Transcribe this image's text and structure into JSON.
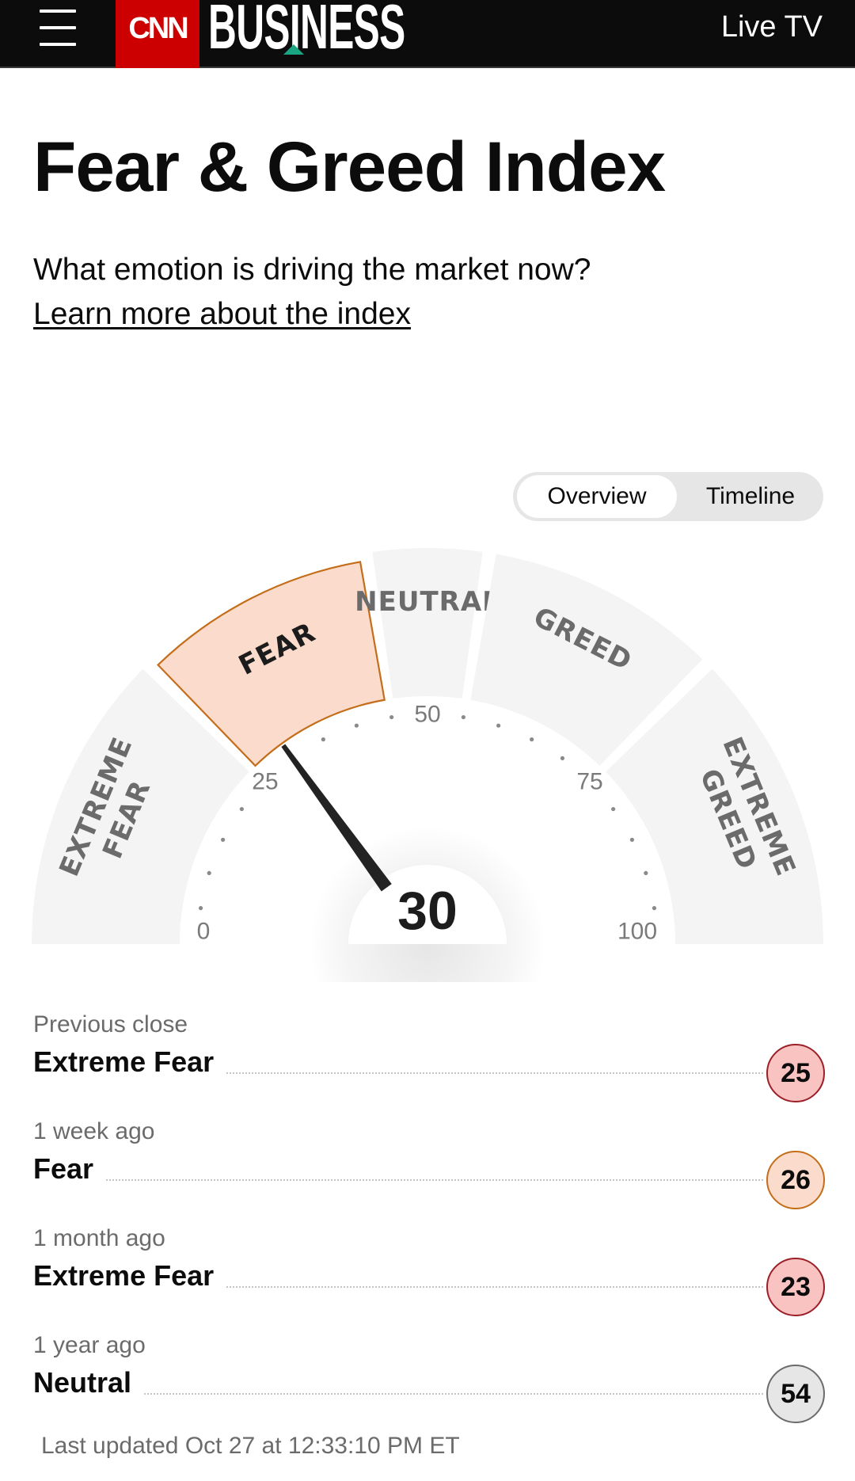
{
  "header": {
    "menu_icon": "hamburger-menu-icon",
    "brand_name": "CNN",
    "section_name": "BUSINESS",
    "live_tv_label": "Live TV",
    "colors": {
      "bar": "#0c0c0c",
      "cnn_red": "#cc0000",
      "accent": "#1aa682"
    }
  },
  "main": {
    "title": "Fear & Greed Index",
    "subtitle": "What emotion is driving the market now?",
    "learn_more": "Learn more about the index"
  },
  "view_toggle": {
    "options": [
      "Overview",
      "Timeline"
    ],
    "selected": "Overview"
  },
  "gauge": {
    "value": 30,
    "min": 0,
    "max": 100,
    "active_segment": "FEAR",
    "segments": [
      {
        "label": "EXTREME FEAR",
        "lines": [
          "EXTREME",
          "FEAR"
        ],
        "from": 0,
        "to": 25
      },
      {
        "label": "FEAR",
        "lines": [
          "FEAR"
        ],
        "from": 25,
        "to": 45
      },
      {
        "label": "NEUTRAL",
        "lines": [
          "NEUTRAL"
        ],
        "from": 45,
        "to": 55
      },
      {
        "label": "GREED",
        "lines": [
          "GREED"
        ],
        "from": 55,
        "to": 75
      },
      {
        "label": "EXTREME GREED",
        "lines": [
          "EXTREME",
          "GREED"
        ],
        "from": 75,
        "to": 100
      }
    ],
    "tick_labels": [
      "0",
      "25",
      "50",
      "75",
      "100"
    ],
    "colors": {
      "segment": "#f4f4f4",
      "active_fill": "#fbdccc",
      "active_stroke": "#c46d1a",
      "label": "#6b6b6b",
      "active_label": "#1c1c1c",
      "needle": "#232323"
    }
  },
  "history": [
    {
      "label": "Previous close",
      "rating": "Extreme Fear",
      "value": "25",
      "fill": "#f8c3c1",
      "stroke": "#9c1f28"
    },
    {
      "label": "1 week ago",
      "rating": "Fear",
      "value": "26",
      "fill": "#fbdccc",
      "stroke": "#c46d1a"
    },
    {
      "label": "1 month ago",
      "rating": "Extreme Fear",
      "value": "23",
      "fill": "#f8c3c1",
      "stroke": "#9c1f28"
    },
    {
      "label": "1 year ago",
      "rating": "Neutral",
      "value": "54",
      "fill": "#e6e6e6",
      "stroke": "#6b6b6b"
    }
  ],
  "last_updated": "Last updated Oct 27 at 12:33:10 PM ET"
}
